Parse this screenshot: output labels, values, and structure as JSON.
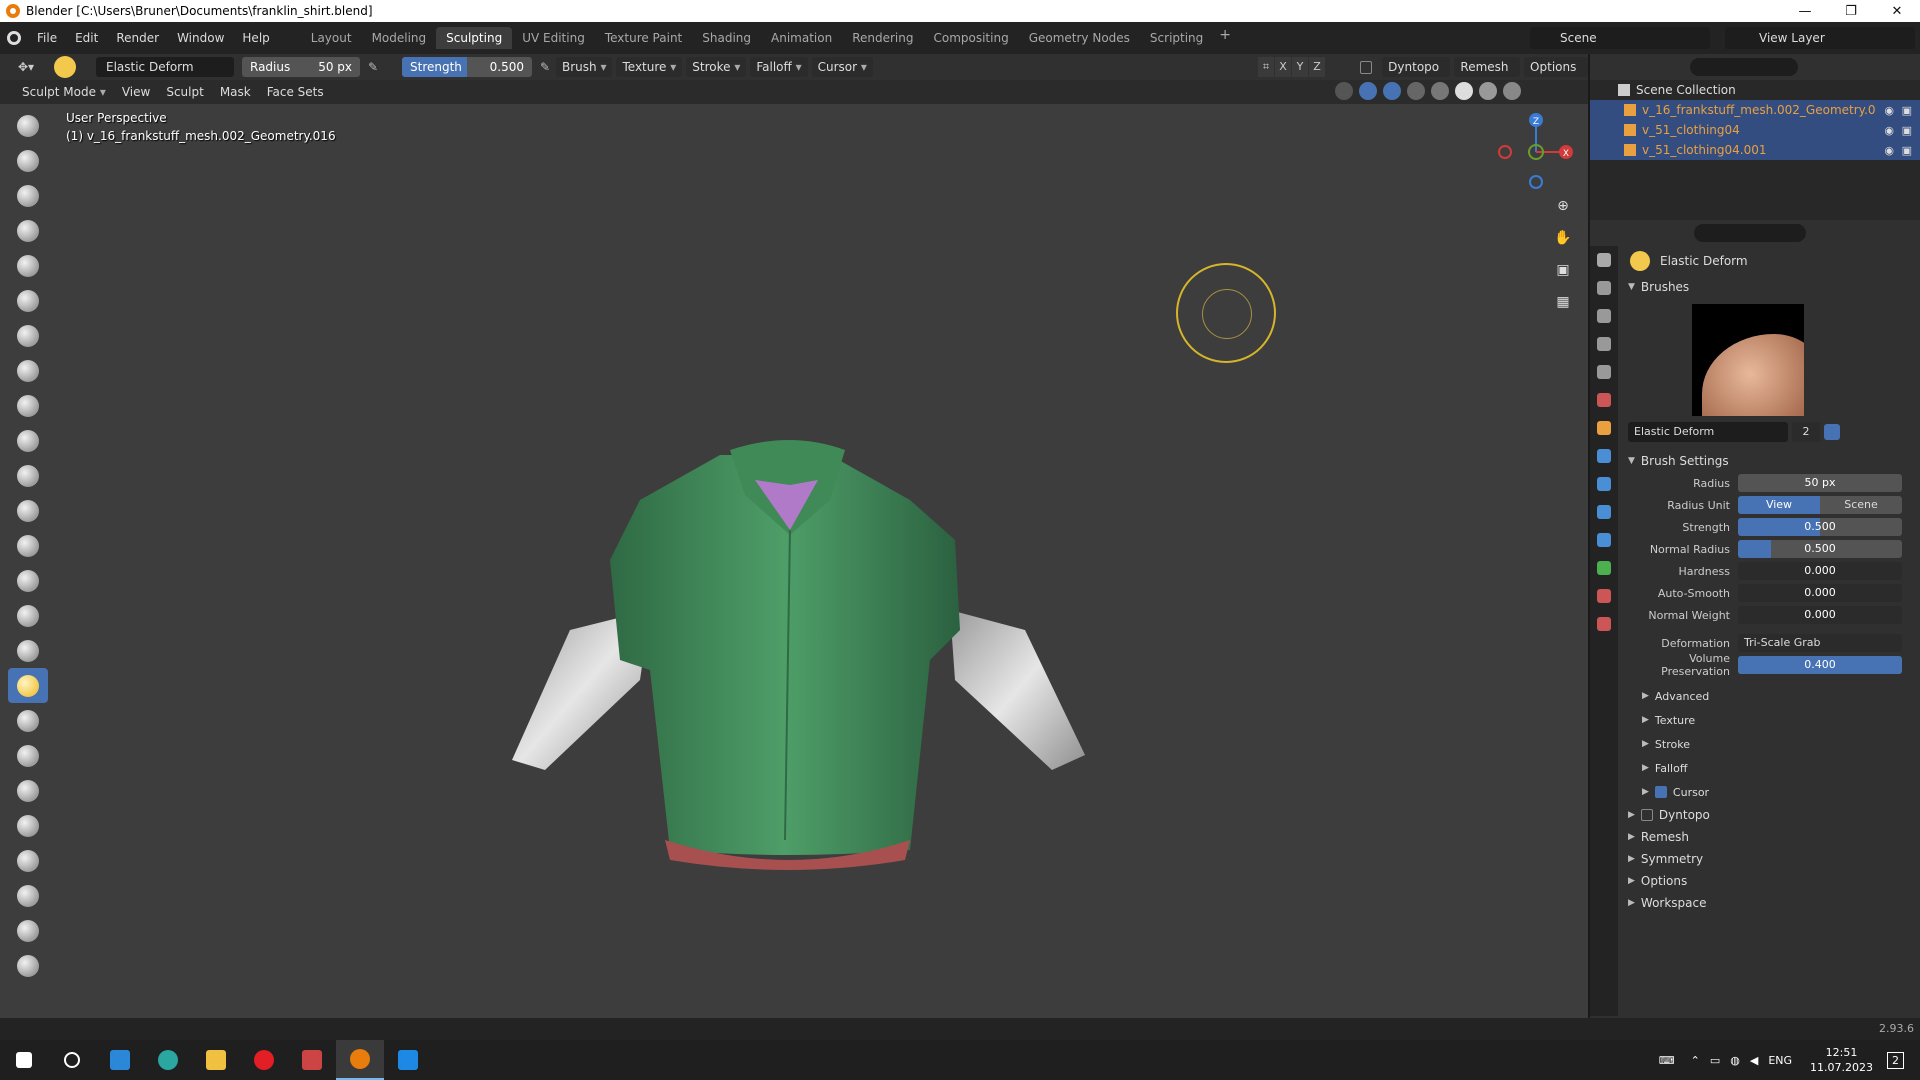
{
  "window": {
    "title": "Blender [C:\\Users\\Bruner\\Documents\\franklin_shirt.blend]",
    "controls": [
      "—",
      "❐",
      "✕"
    ]
  },
  "menu": [
    "File",
    "Edit",
    "Render",
    "Window",
    "Help"
  ],
  "workspaces": [
    "Layout",
    "Modeling",
    "Sculpting",
    "UV Editing",
    "Texture Paint",
    "Shading",
    "Animation",
    "Rendering",
    "Compositing",
    "Geometry Nodes",
    "Scripting"
  ],
  "active_workspace": "Sculpting",
  "scene": "Scene",
  "view_layer": "View Layer",
  "tool_settings": {
    "brush_name": "Elastic Deform",
    "radius_label": "Radius",
    "radius_value": "50 px",
    "strength_label": "Strength",
    "strength_value": "0.500",
    "strength_fraction": 0.5,
    "dropdowns": [
      "Brush",
      "Texture",
      "Stroke",
      "Falloff",
      "Cursor"
    ],
    "symmetry": [
      "X",
      "Y",
      "Z"
    ],
    "dyntopo": "Dyntopo",
    "remesh": "Remesh",
    "options": "Options"
  },
  "viewport_header": {
    "mode": "Sculpt Mode",
    "menus": [
      "View",
      "Sculpt",
      "Mask",
      "Face Sets"
    ]
  },
  "viewport": {
    "perspective": "User Perspective",
    "object": "(1) v_16_frankstuff_mesh.002_Geometry.016"
  },
  "gizmo": {
    "z": "Z",
    "x": "X"
  },
  "outliner": {
    "collection": "Scene Collection",
    "items": [
      {
        "name": "v_16_frankstuff_mesh.002_Geometry.0",
        "selected": true
      },
      {
        "name": "v_51_clothing04",
        "selected": true
      },
      {
        "name": "v_51_clothing04.001",
        "selected": true
      }
    ]
  },
  "properties": {
    "brush_title": "Elastic Deform",
    "brushes_label": "Brushes",
    "brush_field": "Elastic Deform",
    "brush_users": "2",
    "brush_settings_label": "Brush Settings",
    "rows": [
      {
        "label": "Radius",
        "value": "50 px",
        "fill": 0.0
      },
      {
        "label": "Strength",
        "value": "0.500",
        "fill": 0.5
      },
      {
        "label": "Normal Radius",
        "value": "0.500",
        "fill": 0.2
      },
      {
        "label": "Hardness",
        "value": "0.000",
        "fill": 0.0
      },
      {
        "label": "Auto-Smooth",
        "value": "0.000",
        "fill": 0.0
      },
      {
        "label": "Normal Weight",
        "value": "0.000",
        "fill": 0.0
      }
    ],
    "radius_unit_label": "Radius Unit",
    "radius_unit_options": [
      "View",
      "Scene"
    ],
    "deformation_label": "Deformation",
    "deformation_value": "Tri-Scale Grab",
    "volume_label": "Volume Preservation",
    "volume_value": "0.400",
    "volume_fill": 1.0,
    "subpanels": [
      "Advanced",
      "Texture",
      "Stroke",
      "Falloff",
      "Cursor"
    ],
    "cursor_checked": true,
    "panels": [
      "Dyntopo",
      "Remesh",
      "Symmetry",
      "Options",
      "Workspace"
    ]
  },
  "version": "2.93.6",
  "taskbar": {
    "lang": "ENG",
    "time": "12:51",
    "date": "11.07.2023",
    "notifications": "2"
  }
}
